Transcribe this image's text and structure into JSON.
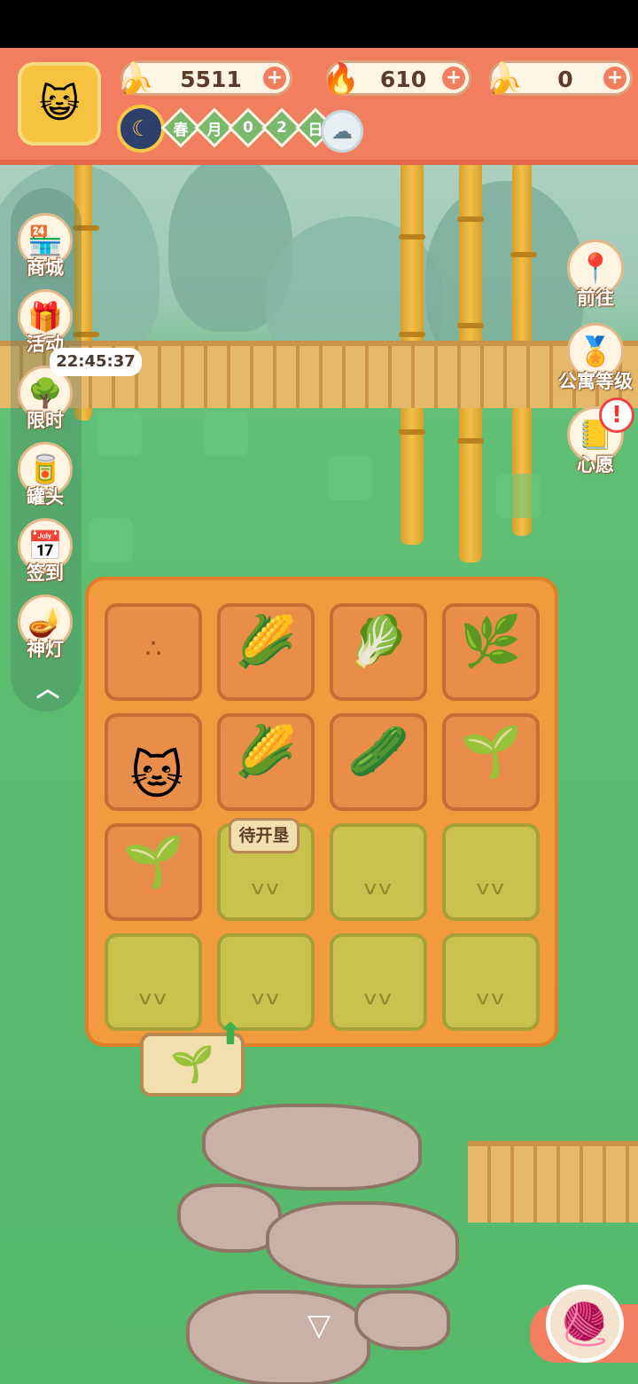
{
  "resources": [
    {
      "name": "banana",
      "icon": "banana-icon",
      "value": "5511"
    },
    {
      "name": "blue-flame",
      "icon": "flame-icon",
      "value": "610"
    },
    {
      "name": "blue-banana",
      "icon": "blue-banana-icon",
      "value": "0"
    }
  ],
  "date": {
    "chars": [
      "春",
      "月",
      "0",
      "2",
      "日"
    ]
  },
  "weather": {
    "icon": "rain-cloud-icon"
  },
  "left_menu": [
    {
      "label": "商城",
      "icon": "shop-icon"
    },
    {
      "label": "活动",
      "icon": "gift-icon"
    },
    {
      "label": "限时",
      "icon": "limited-tree-icon"
    },
    {
      "label": "罐头",
      "icon": "can-icon"
    },
    {
      "label": "签到",
      "icon": "checkin-icon"
    },
    {
      "label": "神灯",
      "icon": "magic-lamp-icon"
    }
  ],
  "timer": "22:45:37",
  "right_menu": [
    {
      "label": "前往",
      "icon": "map-pin-icon"
    },
    {
      "label": "公寓等级",
      "icon": "apartment-level-icon"
    },
    {
      "label": "心愿",
      "icon": "wish-book-icon"
    }
  ],
  "farm": {
    "sign_label": "待开垦",
    "plots": [
      {
        "state": "soil",
        "crop": "seeds"
      },
      {
        "state": "soil",
        "crop": "corn"
      },
      {
        "state": "soil",
        "crop": "leafy"
      },
      {
        "state": "soil",
        "crop": "sprout"
      },
      {
        "state": "soil",
        "crop": "empty"
      },
      {
        "state": "soil",
        "crop": "corn"
      },
      {
        "state": "soil",
        "crop": "star-plant"
      },
      {
        "state": "soil",
        "crop": "seedling"
      },
      {
        "state": "soil",
        "crop": "seedling"
      },
      {
        "state": "grass",
        "crop": "none"
      },
      {
        "state": "grass",
        "crop": "none"
      },
      {
        "state": "grass",
        "crop": "none"
      },
      {
        "state": "grass",
        "crop": "none"
      },
      {
        "state": "grass",
        "crop": "none"
      },
      {
        "state": "grass",
        "crop": "none"
      },
      {
        "state": "grass",
        "crop": "none"
      }
    ]
  },
  "colors": {
    "topbar": "#f17e5f",
    "soil": "#e88d4a",
    "grass_plot": "#c9c24f",
    "field": "#55b96a"
  }
}
